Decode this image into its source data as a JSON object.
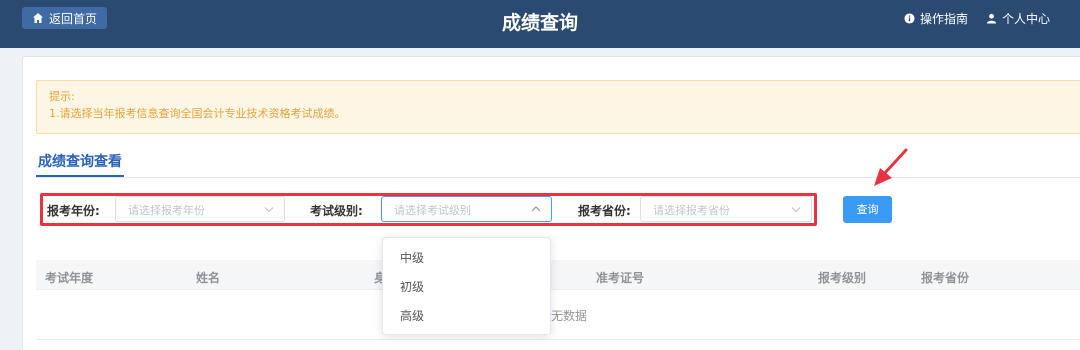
{
  "header": {
    "home_label": "返回首页",
    "title": "成绩查询",
    "guide_label": "操作指南",
    "personal_label": "个人中心"
  },
  "notice": {
    "heading": "提示:",
    "line1": "1.请选择当年报考信息查询全国会计专业技术资格考试成绩。"
  },
  "tab": {
    "label": "成绩查询查看"
  },
  "filters": {
    "year": {
      "label": "报考年份:",
      "placeholder": "请选择报考年份"
    },
    "level": {
      "label": "考试级别:",
      "placeholder": "请选择考试级别"
    },
    "province": {
      "label": "报考省份:",
      "placeholder": "请选择报考省份"
    },
    "query_label": "查询"
  },
  "dropdown": {
    "options": [
      "中级",
      "初级",
      "高级"
    ]
  },
  "table": {
    "columns": [
      "考试年度",
      "姓名",
      "身",
      "准考证号",
      "报考级别",
      "报考省份"
    ],
    "empty_text": "无数据"
  },
  "colors": {
    "header_bg": "#2a4a72",
    "accent": "#3a9bf5",
    "highlight_box": "#e7343f",
    "notice_text": "#e6a23c"
  }
}
